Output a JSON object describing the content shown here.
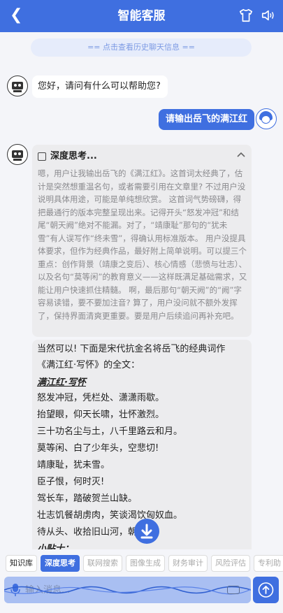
{
  "header": {
    "title": "智能客服",
    "back_icon": "chevron-left-icon",
    "right_icons": [
      "shirt-icon",
      "speaker-icon"
    ],
    "accent": "#3f6fe0"
  },
  "history_link": "== 点击查看历史聊天信息 ==",
  "messages": {
    "greeting": "您好，请问有什么可以帮助您?",
    "user_request": "请输出岳飞的满江红",
    "thinking": {
      "title": "深度思考...",
      "text": "嗯，用户让我输出岳飞的《满江红》。这首词太经典了，估计是突然想重温名句，或者需要引用在文章里? 不过用户没说明具体用途，可能是单纯想欣赏。 这首词气势磅礴，得把最通行的版本完整呈现出来。记得开头“怒发冲冠”和结尾“朝天阙”绝对不能漏。对了，“靖康耻”那句的“犹未雪”有人误写作“终未雪”，得确认用标准版本。 用户没提具体要求，但作为经典作品，最好附上简单说明。可以提三个重点：创作背景（靖康之变后）、核心情感（悲愤与壮志）、以及名句“莫等闲”的教育意义——这样既满足基础需求，又能让用户快速抓住精髓。 啊，最后那句“朝天阙”的“阙”字容易读错，要不要加注音? 算了，用户没问就不额外发挥了，保持界面清爽更重要。要是用户后续追问再补充吧。"
    },
    "answer": {
      "intro_1": "当然可以! 下面是宋代抗金名将岳飞的经典词作",
      "intro_2": "《满江红·写怀》的全文：",
      "poem_title": "满江红·写怀",
      "poem_lines": [
        "怒发冲冠，凭栏处、潇潇雨歇。",
        "抬望眼，仰天长啸，壮怀激烈。",
        "三十功名尘与土，八千里路云和月。",
        "莫等闲、白了少年头，空悲切!",
        "靖康耻，犹未雪。",
        "臣子恨，何时灭!",
        "驾长车，踏破贺兰山缺。",
        "壮志饥餐胡虏肉，笑谈渴饮匈奴血。",
        "待从头、收拾旧山河，朝天阙!"
      ],
      "tip_title": "小贴士："
    }
  },
  "toolbar": {
    "chips": [
      "知识库",
      "深度思考",
      "联网搜索",
      "图像生成",
      "财务审计",
      "风险评估",
      "专利助"
    ]
  },
  "input": {
    "placeholder": "输入消息..."
  },
  "icons": {
    "mic": "microphone-icon",
    "keyboard": "keyboard-icon",
    "send": "send-up-icon",
    "scroll": "scroll-down-icon"
  }
}
